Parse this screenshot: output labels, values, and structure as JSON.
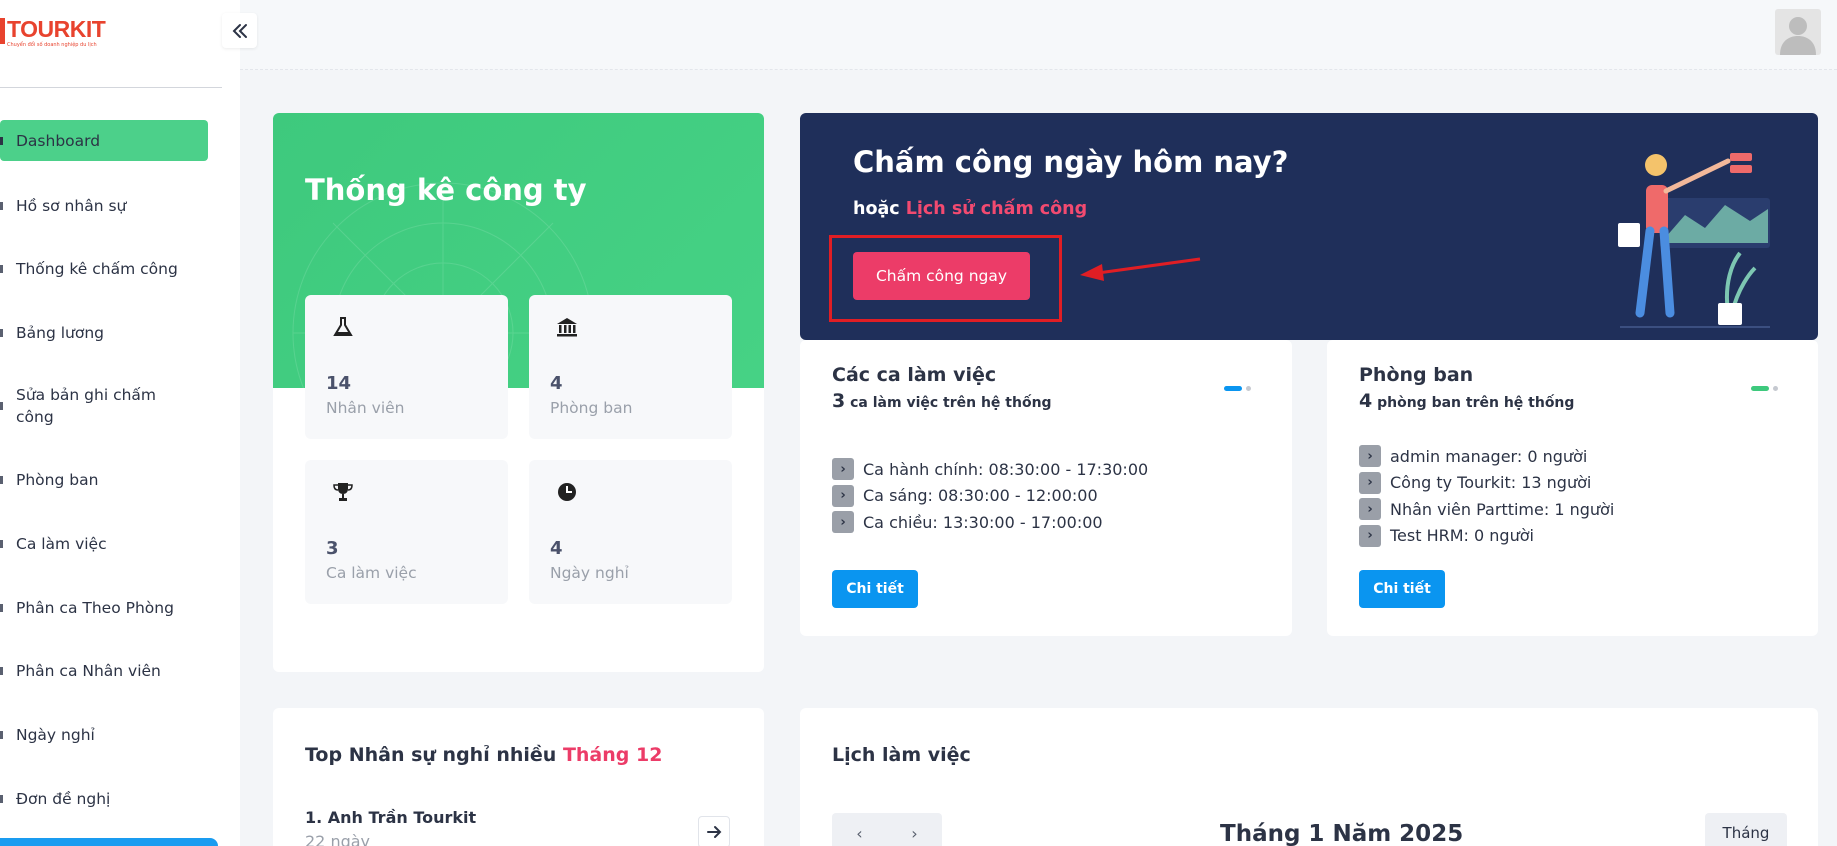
{
  "logo": {
    "title": "TOURKIT",
    "tagline": "Chuyển đổi số doanh nghiệp du lịch"
  },
  "sidebar": {
    "items": [
      {
        "label": "Dashboard",
        "active": true
      },
      {
        "label": "Hồ sơ nhân sự"
      },
      {
        "label": "Thống kê chấm công"
      },
      {
        "label": "Bảng lương"
      },
      {
        "label": "Sửa bản ghi chấm\ncông"
      },
      {
        "label": "Phòng ban"
      },
      {
        "label": "Ca làm việc"
      },
      {
        "label": "Phân ca Theo Phòng"
      },
      {
        "label": "Phân ca Nhân viên"
      },
      {
        "label": "Ngày nghỉ"
      },
      {
        "label": "Đơn đề nghị"
      }
    ]
  },
  "company": {
    "title": "Thống kê công ty",
    "stats": [
      {
        "value": "14",
        "caption": "Nhân viên",
        "icon": "flask-icon"
      },
      {
        "value": "4",
        "caption": "Phòng ban",
        "icon": "bank-icon"
      },
      {
        "value": "3",
        "caption": "Ca làm việc",
        "icon": "trophy-icon"
      },
      {
        "value": "4",
        "caption": "Ngày nghỉ",
        "icon": "clock-icon"
      }
    ]
  },
  "banner": {
    "title": "Chấm công ngày hôm nay?",
    "or_text": "hoặc",
    "history_link": "Lịch sử chấm công",
    "button_label": "Chấm công ngay"
  },
  "shifts": {
    "title": "Các ca làm việc",
    "count": "3",
    "count_suffix": "ca làm việc trên hệ thống",
    "items": [
      "Ca hành chính: 08:30:00 - 17:30:00",
      "Ca sáng: 08:30:00 - 12:00:00",
      "Ca chiều: 13:30:00 - 17:00:00"
    ],
    "detail_label": "Chi tiết",
    "accent": "#0a95f0"
  },
  "departments": {
    "title": "Phòng ban",
    "count": "4",
    "count_suffix": "phòng ban trên hệ thống",
    "items": [
      "admin manager: 0 người",
      "Công ty Tourkit: 13 người",
      "Nhân viên Parttime: 1 người",
      "Test HRM: 0 người"
    ],
    "detail_label": "Chi tiết",
    "accent": "#3ec97d"
  },
  "top_leave": {
    "title": "Top Nhân sự nghỉ nhiều",
    "month": "Tháng 12",
    "person": "1. Anh Trần Tourkit",
    "days": "22 ngày"
  },
  "calendar": {
    "title": "Lịch làm việc",
    "month_title": "Tháng 1 Năm 2025",
    "prev": "‹",
    "next": "›",
    "view_label": "Tháng"
  },
  "colors": {
    "primary_green": "#3ec97d",
    "navy": "#1f2f5a",
    "pink": "#ec3c68",
    "blue": "#0a95f0",
    "logo_red": "#e8432e"
  }
}
